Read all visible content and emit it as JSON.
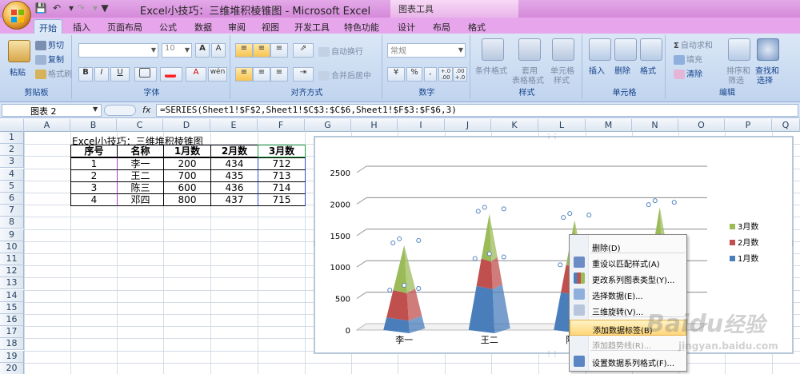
{
  "window": {
    "title": "Excel小技巧：三维堆积棱锥图 - Microsoft Excel",
    "context_tab_group": "图表工具"
  },
  "ribbon_tabs": [
    "开始",
    "插入",
    "页面布局",
    "公式",
    "数据",
    "审阅",
    "视图",
    "开发工具",
    "特色功能",
    "设计",
    "布局",
    "格式"
  ],
  "ribbon": {
    "clipboard": {
      "paste": "粘贴",
      "cut": "剪切",
      "copy": "复制",
      "format_painter": "格式刷",
      "label": "剪贴板"
    },
    "font": {
      "size": "10",
      "bold": "B",
      "italic": "I",
      "underline": "U",
      "label": "字体",
      "grow": "A",
      "shrink": "A",
      "phonetic": "wén"
    },
    "alignment": {
      "wrap": "自动换行",
      "merge": "合并后居中",
      "label": "对齐方式"
    },
    "number": {
      "format": "常规",
      "percent": "%",
      "comma": ",",
      "label": "数字",
      "inc_dec": "+.0 .00",
      "dec_dec": ".00 +.0"
    },
    "styles": {
      "conditional": "条件格式",
      "table1": "套用",
      "table2": "表格格式",
      "cell1": "单元格",
      "cell2": "样式",
      "label": "样式"
    },
    "cells": {
      "insert": "插入",
      "delete": "删除",
      "format": "格式",
      "label": "单元格"
    },
    "editing": {
      "autosum": "自动求和",
      "fill": "填充",
      "clear": "清除",
      "sort1": "排序和",
      "sort2": "筛选",
      "find1": "查找和",
      "find2": "选择",
      "label": "编辑",
      "sigma": "Σ"
    }
  },
  "formula_bar": {
    "name_box": "图表 2",
    "fx": "fx",
    "formula": "=SERIES(Sheet1!$F$2,Sheet1!$C$3:$C$6,Sheet1!$F$3:$F$6,3)"
  },
  "columns": [
    "A",
    "B",
    "C",
    "D",
    "E",
    "F",
    "G",
    "H",
    "I",
    "J",
    "K",
    "L",
    "M",
    "N",
    "O",
    "P",
    "Q"
  ],
  "rows": [
    "1",
    "2",
    "3",
    "4",
    "5",
    "6",
    "7",
    "8",
    "9",
    "10",
    "11",
    "12",
    "13",
    "14",
    "15",
    "16",
    "17",
    "18",
    "19",
    "20"
  ],
  "sheet": {
    "b1_title": "Excel小技巧：三维堆积棱锥图",
    "headers": [
      "序号",
      "名称",
      "1月数",
      "2月数",
      "3月数"
    ],
    "data": [
      [
        "1",
        "李一",
        "200",
        "434",
        "712"
      ],
      [
        "2",
        "王二",
        "700",
        "435",
        "713"
      ],
      [
        "3",
        "陈三",
        "600",
        "436",
        "714"
      ],
      [
        "4",
        "邓四",
        "800",
        "437",
        "715"
      ]
    ]
  },
  "chart_data": {
    "type": "bar",
    "subtype": "3d-stacked-pyramid",
    "categories": [
      "李一",
      "王二",
      "陈三",
      "邓四"
    ],
    "series": [
      {
        "name": "1月数",
        "values": [
          200,
          700,
          600,
          800
        ],
        "color": "#4a7ebb"
      },
      {
        "name": "2月数",
        "values": [
          434,
          435,
          436,
          437
        ],
        "color": "#c0504d"
      },
      {
        "name": "3月数",
        "values": [
          712,
          713,
          714,
          715
        ],
        "color": "#9bbb59"
      }
    ],
    "ylim": [
      0,
      2500
    ],
    "yticks": [
      0,
      500,
      1000,
      1500,
      2000,
      2500
    ],
    "grid": true,
    "legend": "right",
    "legend_order": [
      "3月数",
      "2月数",
      "1月数"
    ],
    "title": "",
    "xlabel": "",
    "ylabel": "",
    "visible_categories": [
      "李一",
      "王二",
      "陈三"
    ]
  },
  "context_menu": {
    "items": [
      {
        "label": "删除(D)",
        "icon": "none",
        "state": "normal"
      },
      {
        "label": "重设以匹配样式(A)",
        "icon": "reset-style-icon",
        "state": "normal"
      },
      {
        "label": "更改系列图表类型(Y)...",
        "icon": "chart-type-icon",
        "state": "normal"
      },
      {
        "label": "选择数据(E)...",
        "icon": "select-data-icon",
        "state": "normal"
      },
      {
        "label": "三维旋转(V)...",
        "icon": "rotate-3d-icon",
        "state": "normal"
      },
      {
        "label": "添加数据标签(B)",
        "icon": "none",
        "state": "highlighted"
      },
      {
        "label": "添加趋势线(R)...",
        "icon": "none",
        "state": "disabled"
      },
      {
        "label": "设置数据系列格式(F)...",
        "icon": "format-series-icon",
        "state": "normal"
      }
    ]
  },
  "watermark": {
    "brand": "Baidu",
    "brand_cn": "经验",
    "url": "jingyan.baidu.com"
  },
  "colors": {
    "accent_titlebar": "#d58ad9",
    "ribbon": "#dbe7f6",
    "series1": "#4a7ebb",
    "series2": "#c0504d",
    "series3": "#9bbb59"
  }
}
